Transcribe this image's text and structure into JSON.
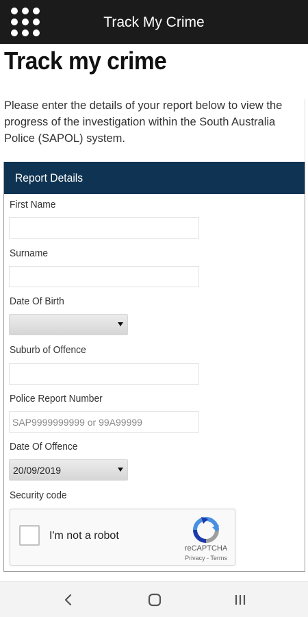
{
  "appbar": {
    "title": "Track My Crime",
    "menu_icon": "grid-menu-icon"
  },
  "page": {
    "heading": "Track my crime",
    "intro": "Please enter the details of your report below to view the progress of the investigation within the South Australia Police (SAPOL) system."
  },
  "form": {
    "header": "Report Details",
    "first_name": {
      "label": "First Name",
      "value": ""
    },
    "surname": {
      "label": "Surname",
      "value": ""
    },
    "date_of_birth": {
      "label": "Date Of Birth",
      "selected": ""
    },
    "suburb": {
      "label": "Suburb of Offence",
      "value": ""
    },
    "report_number": {
      "label": "Police Report Number",
      "placeholder": "SAP9999999999 or 99A99999",
      "value": ""
    },
    "date_of_offence": {
      "label": "Date Of Offence",
      "selected": "20/09/2019"
    },
    "security": {
      "label": "Security code"
    }
  },
  "captcha": {
    "checkbox_label": "I'm not a robot",
    "brand": "reCAPTCHA",
    "links": "Privacy - Terms",
    "checked": false
  },
  "navbar": {
    "icons": [
      "back-icon",
      "home-icon",
      "recent-apps-icon"
    ]
  },
  "colors": {
    "appbar": "#1b1b1b",
    "panel_header": "#0f3352",
    "navbar": "#f3f3f3"
  }
}
